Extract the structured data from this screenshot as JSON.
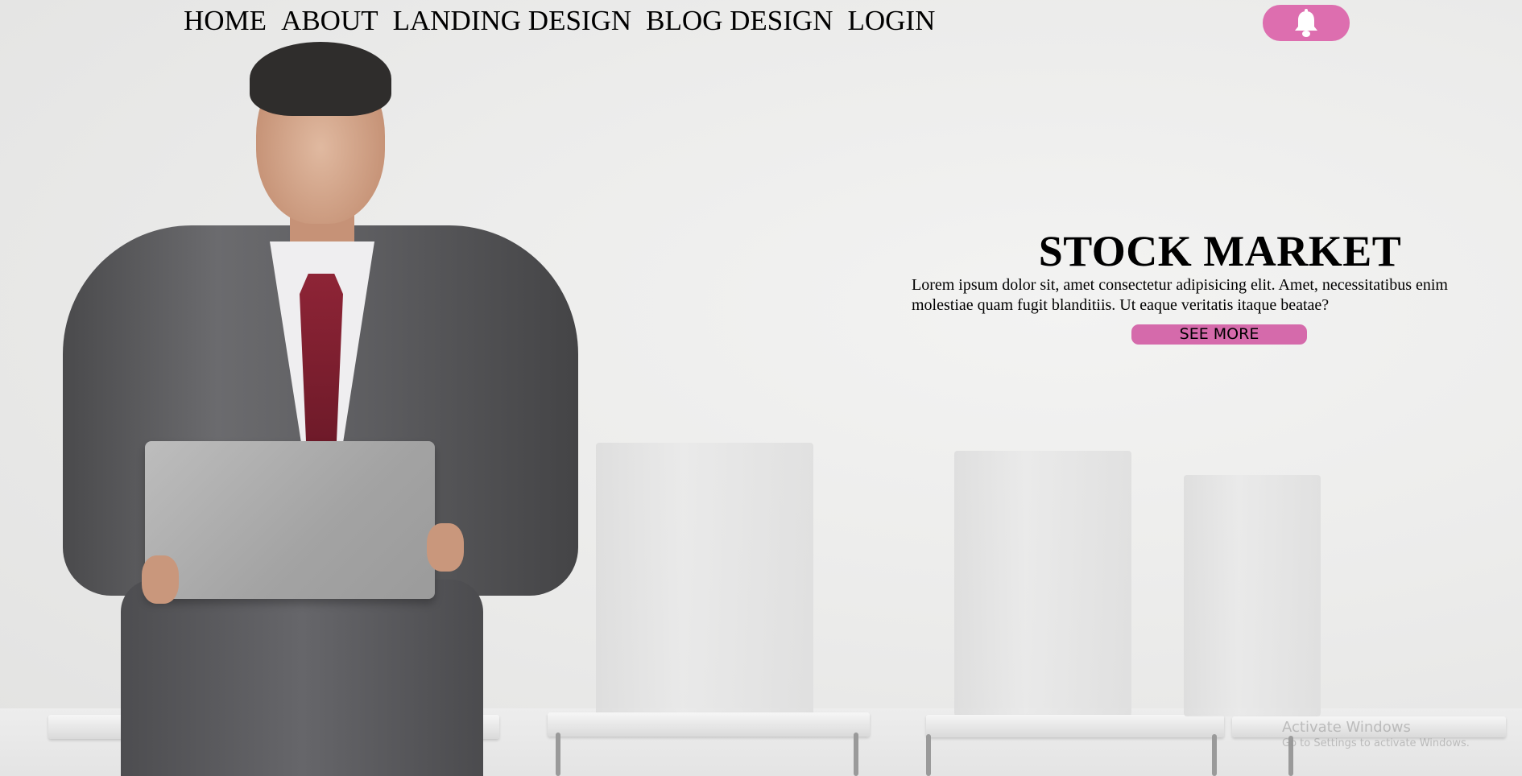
{
  "nav": {
    "items": [
      {
        "label": "HOME"
      },
      {
        "label": "ABOUT"
      },
      {
        "label": "LANDING DESIGN"
      },
      {
        "label": "BLOG DESIGN"
      },
      {
        "label": "LOGIN"
      }
    ]
  },
  "notification": {
    "icon": "bell-icon",
    "color": "#dd6eaf"
  },
  "hero": {
    "title": "STOCK MARKET",
    "text": "Lorem ipsum dolor sit, amet consectetur adipisicing elit. Amet, necessitatibus enim molestiae quam fugit blanditiis. Ut eaque veritatis itaque beatae?",
    "button_label": "SEE MORE",
    "button_color": "#d56aab"
  },
  "watermark": {
    "title": "Activate Windows",
    "subtitle": "Go to Settings to activate Windows."
  }
}
